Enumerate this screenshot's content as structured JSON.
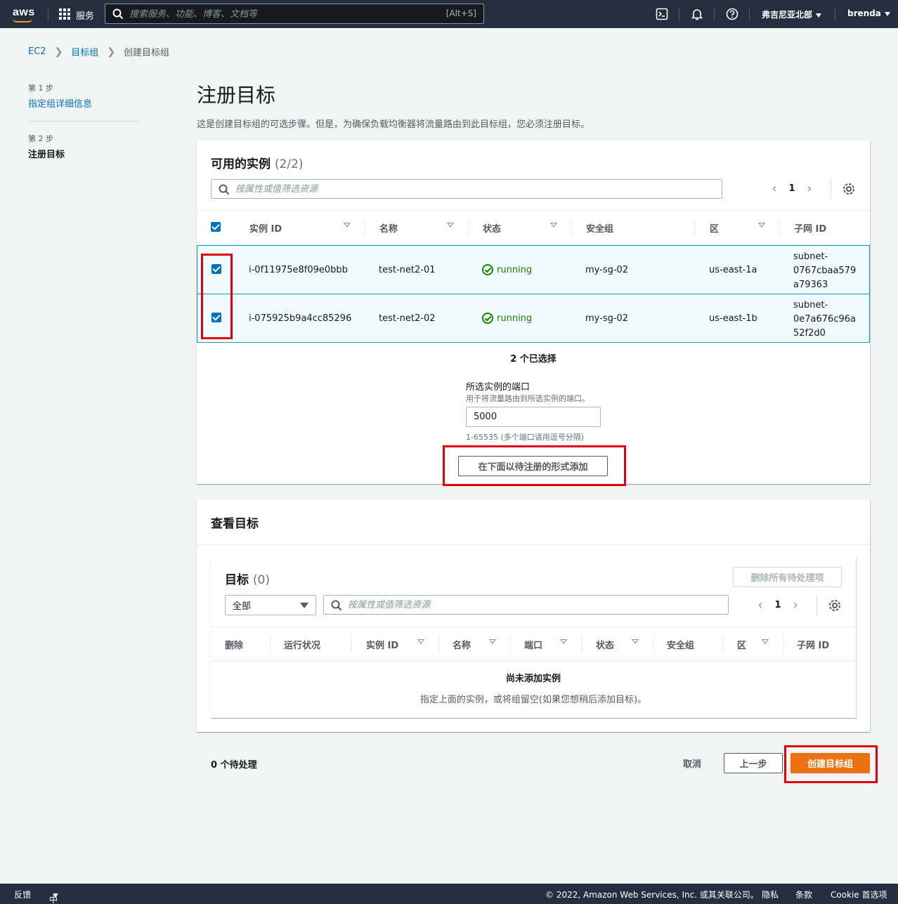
{
  "topbar": {
    "logo": "aws",
    "services_label": "服务",
    "search_placeholder": "搜索服务、功能、博客、文档等",
    "search_hotkey": "[Alt+S]",
    "region": "弗吉尼亚北部",
    "user": "brenda",
    "icons": [
      "grid-icon",
      "search-icon",
      "cloudshell-icon",
      "bell-icon",
      "help-icon"
    ]
  },
  "breadcrumb": {
    "items": [
      "EC2",
      "目标组",
      "创建目标组"
    ]
  },
  "steps": [
    {
      "num": "第 1 步",
      "label": "指定组详细信息"
    },
    {
      "num": "第 2 步",
      "label": "注册目标"
    }
  ],
  "page": {
    "title": "注册目标",
    "description": "这是创建目标组的可选步骤。但是，为确保负载均衡器将流量路由到此目标组，您必须注册目标。"
  },
  "available": {
    "title": "可用的实例",
    "count": "(2/2)",
    "filter_placeholder": "按属性或值筛选资源",
    "page": "1",
    "columns": [
      "实例 ID",
      "名称",
      "状态",
      "安全组",
      "区",
      "子网 ID"
    ],
    "rows": [
      {
        "id": "i-0f11975e8f09e0bbb",
        "name": "test-net2-01",
        "state": "running",
        "sg": "my-sg-02",
        "zone": "us-east-1a",
        "subnet_1": "subnet-",
        "subnet_2": "0767cbaa579",
        "subnet_3": "a79363"
      },
      {
        "id": "i-075925b9a4cc85296",
        "name": "test-net2-02",
        "state": "running",
        "sg": "my-sg-02",
        "zone": "us-east-1b",
        "subnet_1": "subnet-",
        "subnet_2": "0e7a676c96a",
        "subnet_3": "52f2d0"
      }
    ],
    "selected": "2 个已选择",
    "port_label": "所选实例的端口",
    "port_hint": "用于将流量路由到所选实例的端口。",
    "port_value": "5000",
    "port_range": "1-65535 (多个端口请用逗号分隔)",
    "add_button": "在下面以待注册的形式添加"
  },
  "review": {
    "title": "查看目标",
    "targets_title": "目标",
    "targets_count": "(0)",
    "remove_all": "删除所有待处理项",
    "select_value": "全部",
    "filter_placeholder": "按属性或值筛选资源",
    "page": "1",
    "columns": [
      "删除",
      "运行状况",
      "实例 ID",
      "名称",
      "端口",
      "状态",
      "安全组",
      "区",
      "子网 ID"
    ],
    "empty_title": "尚未添加实例",
    "empty_desc": "指定上面的实例，或将组留空(如果您想稍后添加目标)。"
  },
  "actions": {
    "pending": "0 个待处理",
    "cancel": "取消",
    "previous": "上一步",
    "create": "创建目标组"
  },
  "footer": {
    "feedback": "反馈",
    "language": "中文(简体)",
    "copyright": "© 2022, Amazon Web Services, Inc. 或其关联公司。",
    "privacy": "隐私",
    "terms": "条款",
    "cookies": "Cookie 首选项"
  },
  "colors": {
    "topbar": "#232f3e",
    "link": "#0073bb",
    "primary": "#ec7211",
    "success": "#1d8102",
    "highlight": "#e3000f"
  }
}
